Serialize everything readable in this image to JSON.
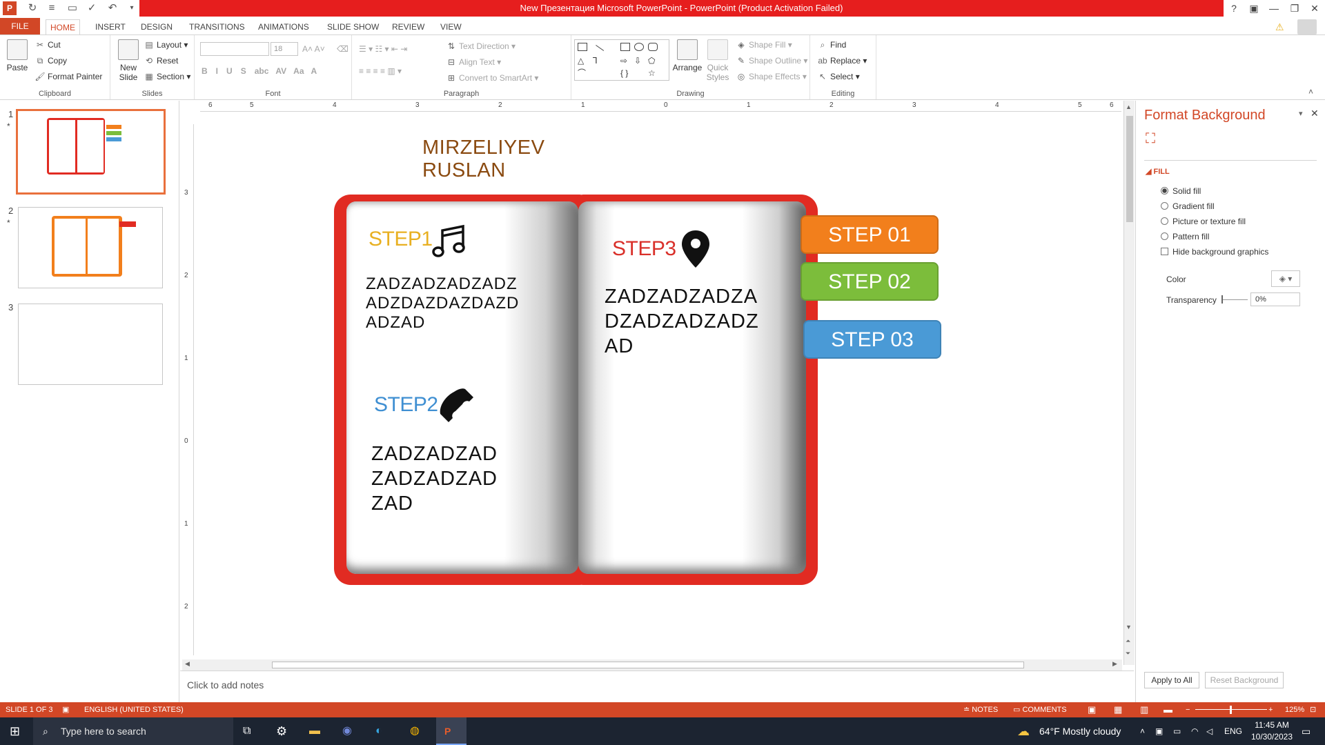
{
  "window": {
    "title": "New Презентация Microsoft PowerPoint -  PowerPoint (Product Activation Failed)",
    "help": "?",
    "minimize": "—",
    "restore": "❐",
    "close": "✕"
  },
  "tabs": [
    "FILE",
    "HOME",
    "INSERT",
    "DESIGN",
    "TRANSITIONS",
    "ANIMATIONS",
    "SLIDE SHOW",
    "REVIEW",
    "VIEW"
  ],
  "ribbon": {
    "clipboard": {
      "paste": "Paste",
      "cut": "Cut",
      "copy": "Copy",
      "format_painter": "Format Painter",
      "label": "Clipboard"
    },
    "slides": {
      "new_slide": "New Slide",
      "layout": "Layout",
      "reset": "Reset",
      "section": "Section",
      "label": "Slides"
    },
    "font": {
      "size": "18",
      "label": "Font",
      "buttons": [
        "B",
        "I",
        "U",
        "S",
        "abc",
        "AV",
        "Aa",
        "A"
      ]
    },
    "paragraph": {
      "text_direction": "Text Direction",
      "align_text": "Align Text",
      "smartart": "Convert to SmartArt",
      "label": "Paragraph"
    },
    "drawing": {
      "arrange": "Arrange",
      "quick_styles": "Quick Styles",
      "shape_fill": "Shape Fill",
      "shape_outline": "Shape Outline",
      "shape_effects": "Shape Effects",
      "label": "Drawing"
    },
    "editing": {
      "find": "Find",
      "replace": "Replace",
      "select": "Select",
      "label": "Editing"
    }
  },
  "slides_panel": [
    {
      "num": "1",
      "star": "*"
    },
    {
      "num": "2",
      "star": "*"
    },
    {
      "num": "3",
      "star": ""
    }
  ],
  "ruler": {
    "h": [
      "6",
      "5",
      "4",
      "3",
      "2",
      "1",
      "0",
      "1",
      "2",
      "3",
      "4",
      "5",
      "6"
    ],
    "v": [
      "3",
      "2",
      "1",
      "0",
      "1",
      "2"
    ]
  },
  "slide": {
    "author": "MIRZELIYEV RUSLAN",
    "step1": {
      "label": "STEP1",
      "body": "ZADZADZADZADZ ADZDAZDAZDAZD ADZAD",
      "icon": "music-note-icon",
      "color": "#e8b022"
    },
    "step2": {
      "label": "STEP2",
      "body": "ZADZADZAD ZADZADZAD ZAD",
      "icon": "phone-icon",
      "color": "#3f8fd2"
    },
    "step3": {
      "label": "STEP3",
      "body": "ZADZADZADZA DZADZADZADZ AD",
      "icon": "map-pin-icon",
      "color": "#d9302a"
    },
    "buttons": [
      {
        "label": "STEP 01",
        "color": "#f27f1c"
      },
      {
        "label": "STEP 02",
        "color": "#7cbd3b"
      },
      {
        "label": "STEP 03",
        "color": "#4a9ad6"
      }
    ]
  },
  "notes": {
    "placeholder": "Click to add notes"
  },
  "pane": {
    "title": "Format Background",
    "section": "FILL",
    "options": [
      "Solid fill",
      "Gradient fill",
      "Picture or texture fill",
      "Pattern fill"
    ],
    "hide_bg": "Hide background graphics",
    "color_label": "Color",
    "transparency_label": "Transparency",
    "transparency_value": "0%",
    "apply_all": "Apply to All",
    "reset_bg": "Reset Background"
  },
  "status": {
    "slide": "SLIDE 1 OF 3",
    "language": "ENGLISH (UNITED STATES)",
    "notes": "NOTES",
    "comments": "COMMENTS",
    "zoom": "125%"
  },
  "taskbar": {
    "search": "Type here to search",
    "weather": "64°F  Mostly cloudy",
    "lang": "ENG",
    "time": "11:45 AM",
    "date": "10/30/2023"
  }
}
